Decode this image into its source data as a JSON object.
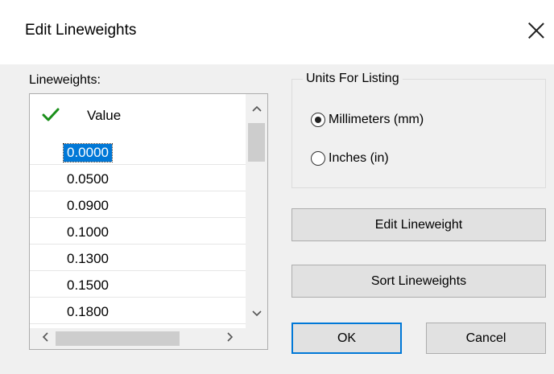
{
  "dialog": {
    "title": "Edit Lineweights",
    "close_icon": "close-icon"
  },
  "lineweights": {
    "label": "Lineweights:",
    "header": "Value",
    "header_icon": "checkmark-icon",
    "check_color": "#1a8f1a",
    "rows": [
      "0.0000",
      "0.0500",
      "0.0900",
      "0.1000",
      "0.1300",
      "0.1500",
      "0.1800"
    ],
    "selected_index": 0,
    "selection_color": "#0078d7"
  },
  "units": {
    "title": "Units For Listing",
    "options": [
      "Millimeters (mm)",
      "Inches (in)"
    ],
    "selected": "Millimeters (mm)"
  },
  "buttons": {
    "edit": "Edit Lineweight",
    "sort": "Sort Lineweights",
    "ok": "OK",
    "cancel": "Cancel"
  },
  "scrollbars": {
    "up_glyph": "^",
    "down_glyph": "v",
    "left_glyph": "<",
    "right_glyph": ">"
  }
}
